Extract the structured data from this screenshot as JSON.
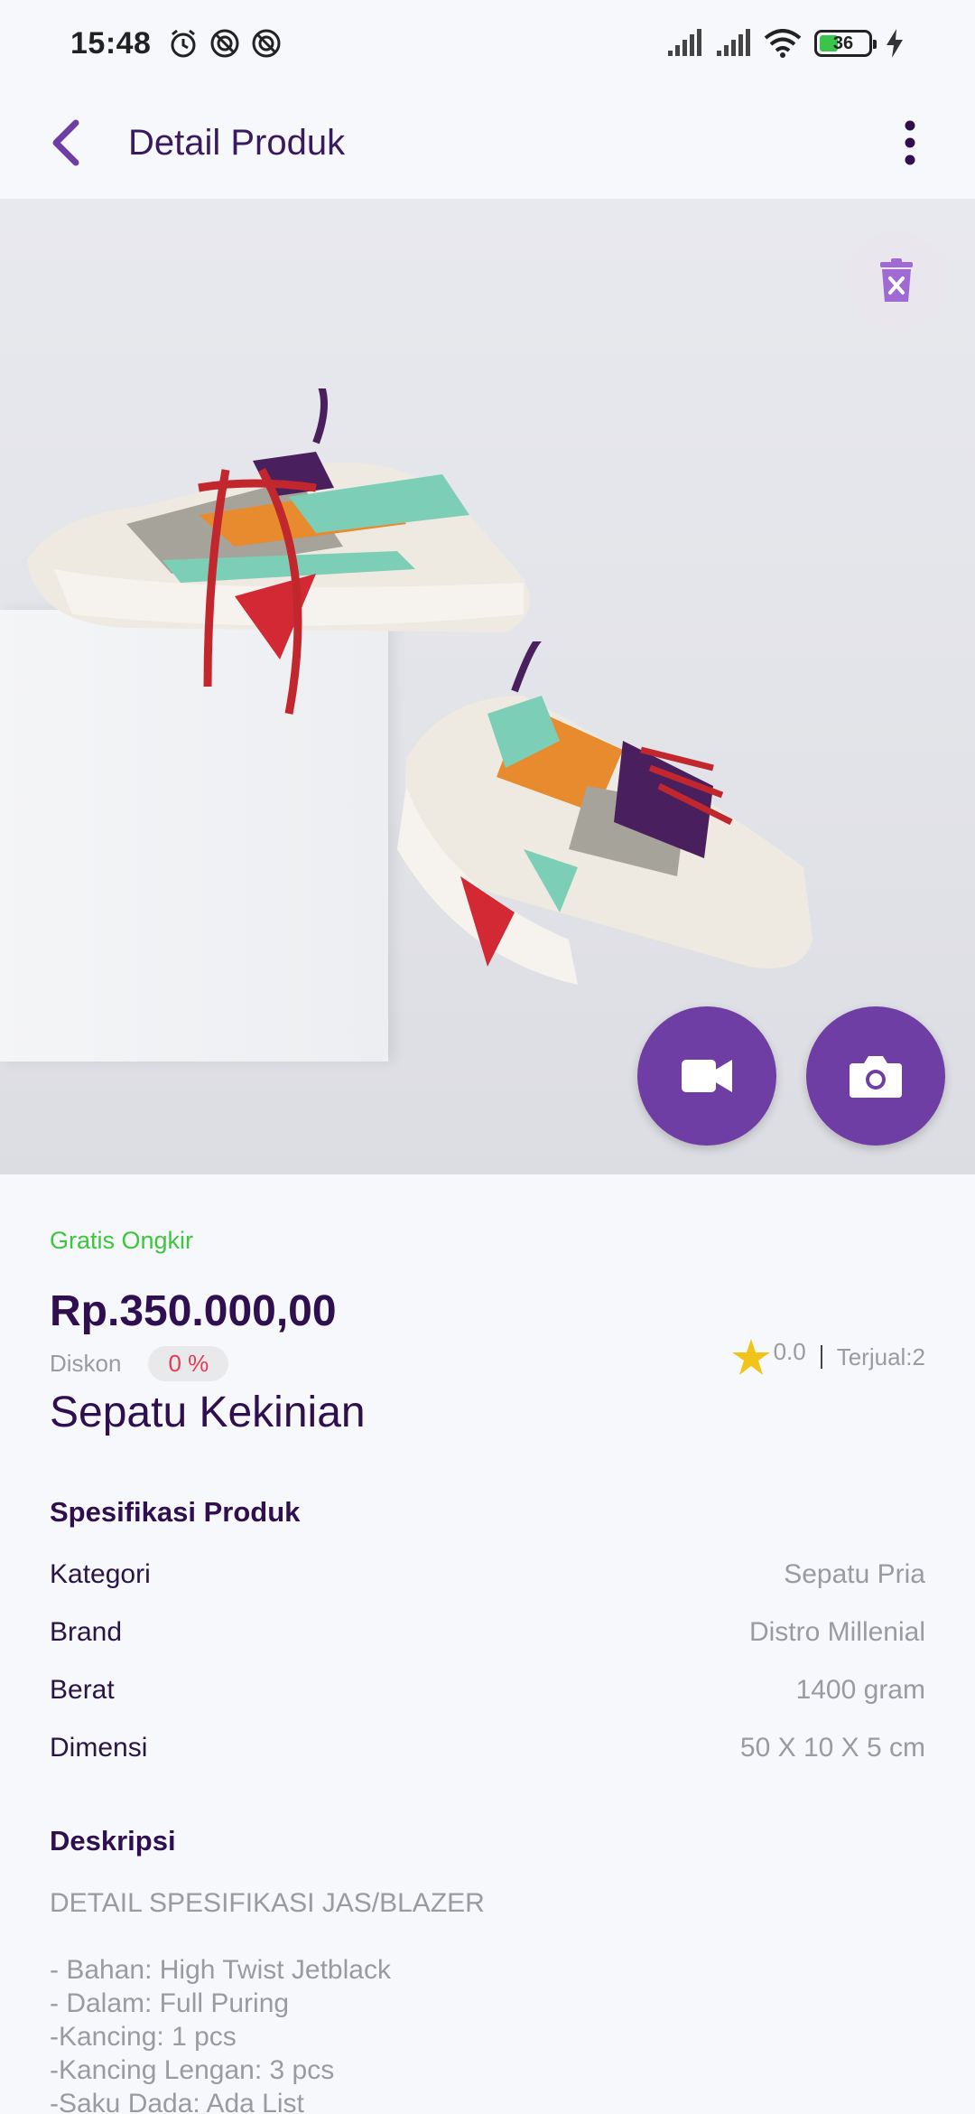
{
  "status_bar": {
    "time": "15:48",
    "battery": "36",
    "icons": [
      "alarm-icon",
      "vpn-icon",
      "vpn-icon",
      "signal-icon",
      "signal-icon",
      "wifi-icon",
      "battery-icon",
      "charging-icon"
    ]
  },
  "app_bar": {
    "title": "Detail Produk"
  },
  "product": {
    "free_shipping": "Gratis Ongkir",
    "price": "Rp.350.000,00",
    "discount_label": "Diskon",
    "discount_value": "0 %",
    "rating": "0.0",
    "sold": "Terjual:2",
    "name": "Sepatu Kekinian"
  },
  "specs": {
    "title": "Spesifikasi Produk",
    "rows": [
      {
        "key": "Kategori",
        "value": "Sepatu Pria"
      },
      {
        "key": "Brand",
        "value": "Distro Millenial"
      },
      {
        "key": "Berat",
        "value": "1400 gram"
      },
      {
        "key": "Dimensi",
        "value": "50 X 10 X 5 cm"
      }
    ]
  },
  "description": {
    "title": "Deskripsi",
    "heading": "DETAIL SPESIFIKASI JAS/BLAZER",
    "lines": [
      "- Bahan: High Twist Jetblack",
      "- Dalam: Full Puring",
      "-Kancing: 1 pcs",
      "-Kancing Lengan: 3 pcs",
      "-Saku Dada: Ada List"
    ]
  },
  "colors": {
    "accent": "#6f3ea4",
    "title_text": "#2f0f4f",
    "free_shipping": "#3cc63c",
    "discount": "#e23b55",
    "star": "#f0c419"
  }
}
